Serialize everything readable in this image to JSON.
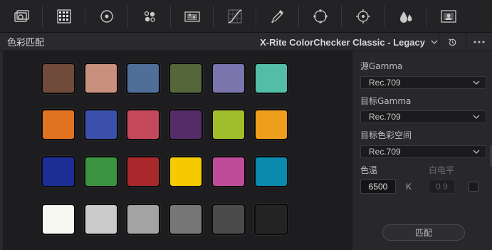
{
  "toolbar": {
    "tools": [
      {
        "icon": "camera-raw-icon"
      },
      {
        "icon": "color-match-icon",
        "active": true
      },
      {
        "icon": "color-wheels-icon"
      },
      {
        "icon": "hdr-wheels-icon"
      },
      {
        "icon": "rgb-mixer-icon"
      },
      {
        "icon": "curves-icon"
      },
      {
        "icon": "qualifier-icon"
      },
      {
        "icon": "window-icon"
      },
      {
        "icon": "tracker-icon"
      },
      {
        "icon": "blur-icon"
      },
      {
        "icon": "key-icon"
      }
    ]
  },
  "header": {
    "title": "色彩匹配",
    "preset": "X-Rite ColorChecker Classic - Legacy",
    "reset_icon": "reset-icon",
    "more_icon": "more-options-icon"
  },
  "swatches": {
    "rows": [
      [
        "#704a3a",
        "#c9907e",
        "#4f6f99",
        "#54663a",
        "#7a75ad",
        "#54bda8"
      ],
      [
        "#e07220",
        "#3a50ab",
        "#c4485a",
        "#552c66",
        "#a0be2c",
        "#ee9e1c"
      ],
      [
        "#1a2e96",
        "#3a9440",
        "#a8282c",
        "#f5cb00",
        "#be4c98",
        "#0a8aad"
      ],
      [
        "#f8f8f3",
        "#cbcbcb",
        "#a3a3a3",
        "#777777",
        "#4b4b4b",
        "#242424"
      ]
    ]
  },
  "settings": {
    "source_gamma_label": "源Gamma",
    "source_gamma_value": "Rec.709",
    "target_gamma_label": "目标Gamma",
    "target_gamma_value": "Rec.709",
    "target_colorspace_label": "目标色彩空间",
    "target_colorspace_value": "Rec.709",
    "color_temp_label": "色温",
    "color_temp_value": "6500",
    "color_temp_unit": "K",
    "white_level_label": "白电平",
    "white_level_value": "0.9",
    "white_level_checked": false,
    "match_button": "匹配"
  },
  "colors": {
    "accent_icon": "#d0d0d0",
    "panel_bg": "#28282c",
    "swatch_bg": "#1d1d20"
  }
}
